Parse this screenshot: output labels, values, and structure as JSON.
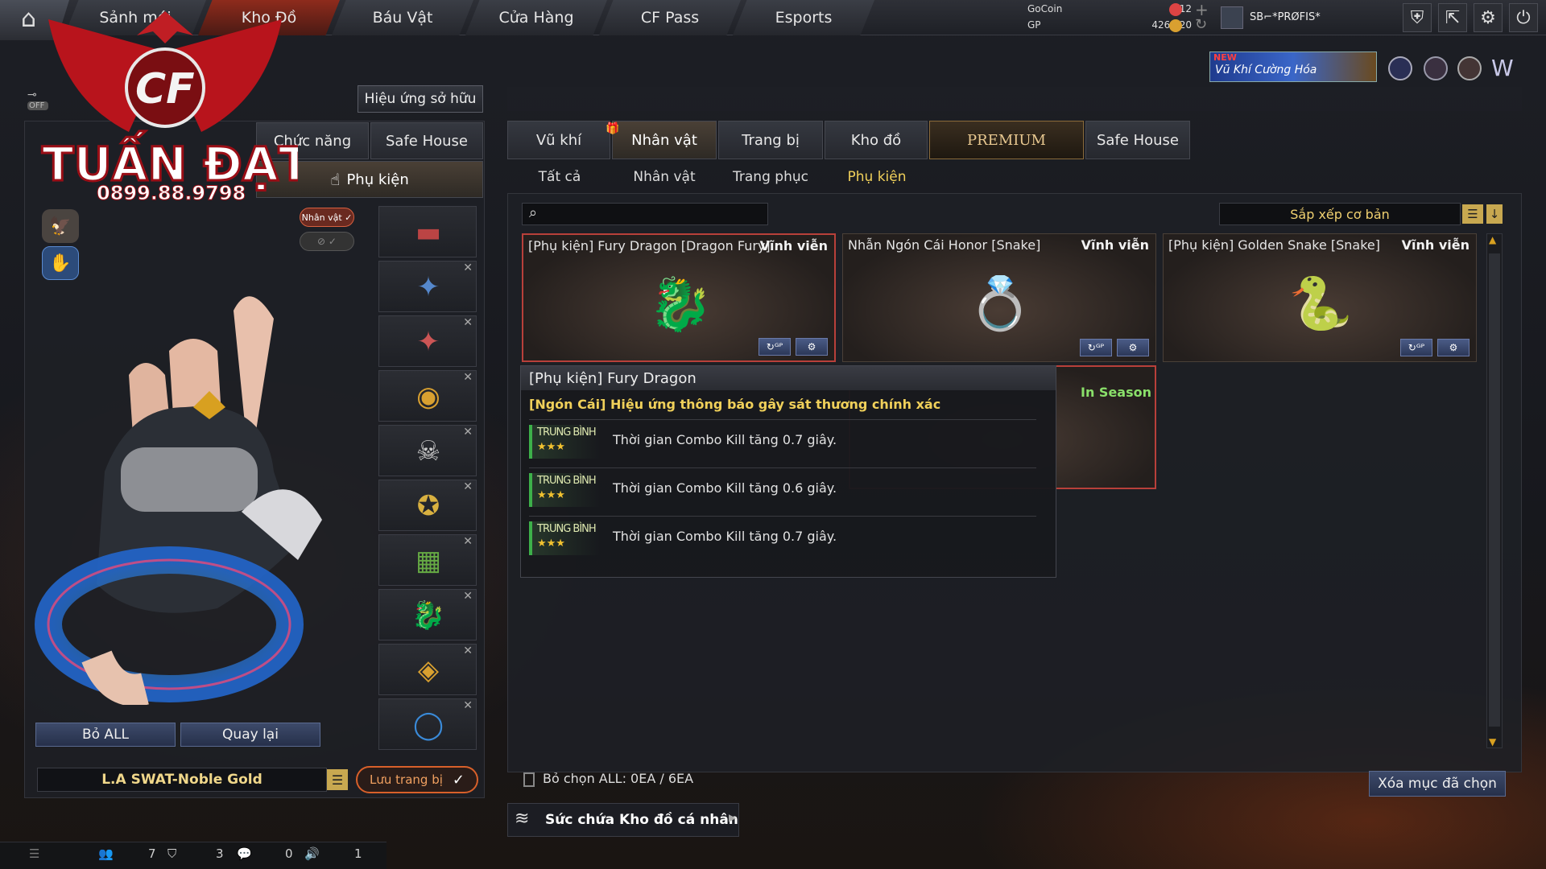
{
  "nav": {
    "home_icon": "home-icon",
    "tabs": [
      "Sảnh mới",
      "Kho Đồ",
      "Báu Vật",
      "Cửa Hàng",
      "CF Pass",
      "Esports"
    ],
    "active_tab": "Kho Đồ"
  },
  "currency": {
    "gocoin_label": "GoCoin",
    "gocoin_value": "12",
    "gp_label": "GP",
    "gp_value": "426,120"
  },
  "player": {
    "name": "SB⌐*PRØFIS*"
  },
  "promo": {
    "new_badge": "NEW",
    "text": "Vũ Khí Cường Hóa"
  },
  "logo": {
    "brand": "CF",
    "title": "TUẤN ĐẠT",
    "phone": "0899.88.9798"
  },
  "left": {
    "toggle_label": "OFF",
    "effect_button": "Hiệu ứng sở hữu",
    "tabs": [
      "Chức năng",
      "Safe House"
    ],
    "accessory_tab": "Phụ kiện",
    "character_tag": "Nhân vật ✓",
    "remove_all": "Bỏ ALL",
    "back": "Quay lại",
    "loadout_name": "L.A SWAT-Noble Gold",
    "save_loadout": "Lưu trang bị"
  },
  "main": {
    "tabs": [
      "Vũ khí",
      "Nhân vật",
      "Trang bị",
      "Kho đồ",
      "PREMIUM",
      "Safe House"
    ],
    "active_tab": "Nhân vật",
    "subtabs": [
      "Tất cả",
      "Nhân vật",
      "Trang phục",
      "Phụ kiện"
    ],
    "active_subtab": "Phụ kiện",
    "search_placeholder": "",
    "sort_label": "Sắp xếp cơ bản",
    "items": [
      {
        "name": "[Phụ kiện] Fury Dragon [Dragon Fury]",
        "duration": "Vĩnh viễn",
        "icon": "dragon-icon"
      },
      {
        "name": "Nhẫn Ngón Cái Honor [Snake]",
        "duration": "Vĩnh viễn",
        "icon": "ring-icon"
      },
      {
        "name": "[Phụ kiện] Golden Snake [Snake]",
        "duration": "Vĩnh viễn",
        "icon": "snake-icon"
      }
    ],
    "hidden_card_status": "In Season",
    "deselect_label": "Bỏ chọn ALL: 0EA / 6EA",
    "delete_selected": "Xóa mục đã chọn",
    "capacity_label": "Sức chứa Kho đồ cá nhân"
  },
  "tooltip": {
    "title": "[Phụ kiện] Fury Dragon",
    "subtitle": "[Ngón Cái] Hiệu ứng thông báo gây sát thương chính xác",
    "rows": [
      {
        "level": "TRUNG BÌNH",
        "stars": "★★★",
        "text": "Thời gian Combo Kill tăng 0.7 giây."
      },
      {
        "level": "TRUNG BÌNH",
        "stars": "★★★",
        "text": "Thời gian Combo Kill tăng 0.6 giây."
      },
      {
        "level": "TRUNG BÌNH",
        "stars": "★★★",
        "text": "Thời gian Combo Kill tăng 0.7 giây."
      }
    ]
  },
  "status": {
    "friends": "7",
    "clan": "3",
    "chat": "0",
    "volume": "1"
  }
}
